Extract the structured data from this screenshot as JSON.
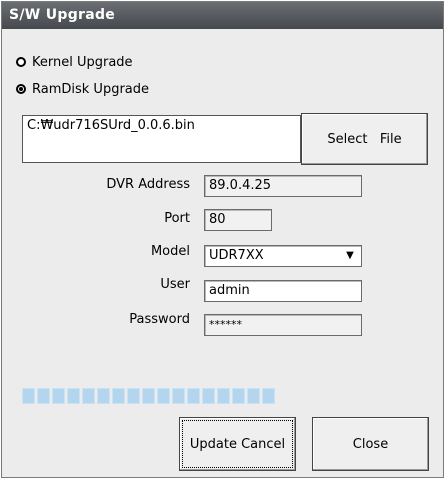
{
  "window": {
    "title": "S/W Upgrade"
  },
  "upgrade_type": {
    "options": [
      {
        "label": "Kernel Upgrade",
        "checked": false
      },
      {
        "label": "RamDisk Upgrade",
        "checked": true
      }
    ]
  },
  "file": {
    "path": "C:₩udr716SUrd_0.0.6.bin",
    "select_label": "Select   File"
  },
  "form": {
    "dvr_address_label": "DVR Address",
    "dvr_address_value": "89.0.4.25",
    "port_label": "Port",
    "port_value": "80",
    "model_label": "Model",
    "model_value": "UDR7XX",
    "user_label": "User",
    "user_value": "admin",
    "password_label": "Password",
    "password_value": "******"
  },
  "progress": {
    "filled_fraction": 0.75,
    "segments": 23
  },
  "buttons": {
    "update_cancel_label": "Update Cancel",
    "close_label": "Close"
  }
}
